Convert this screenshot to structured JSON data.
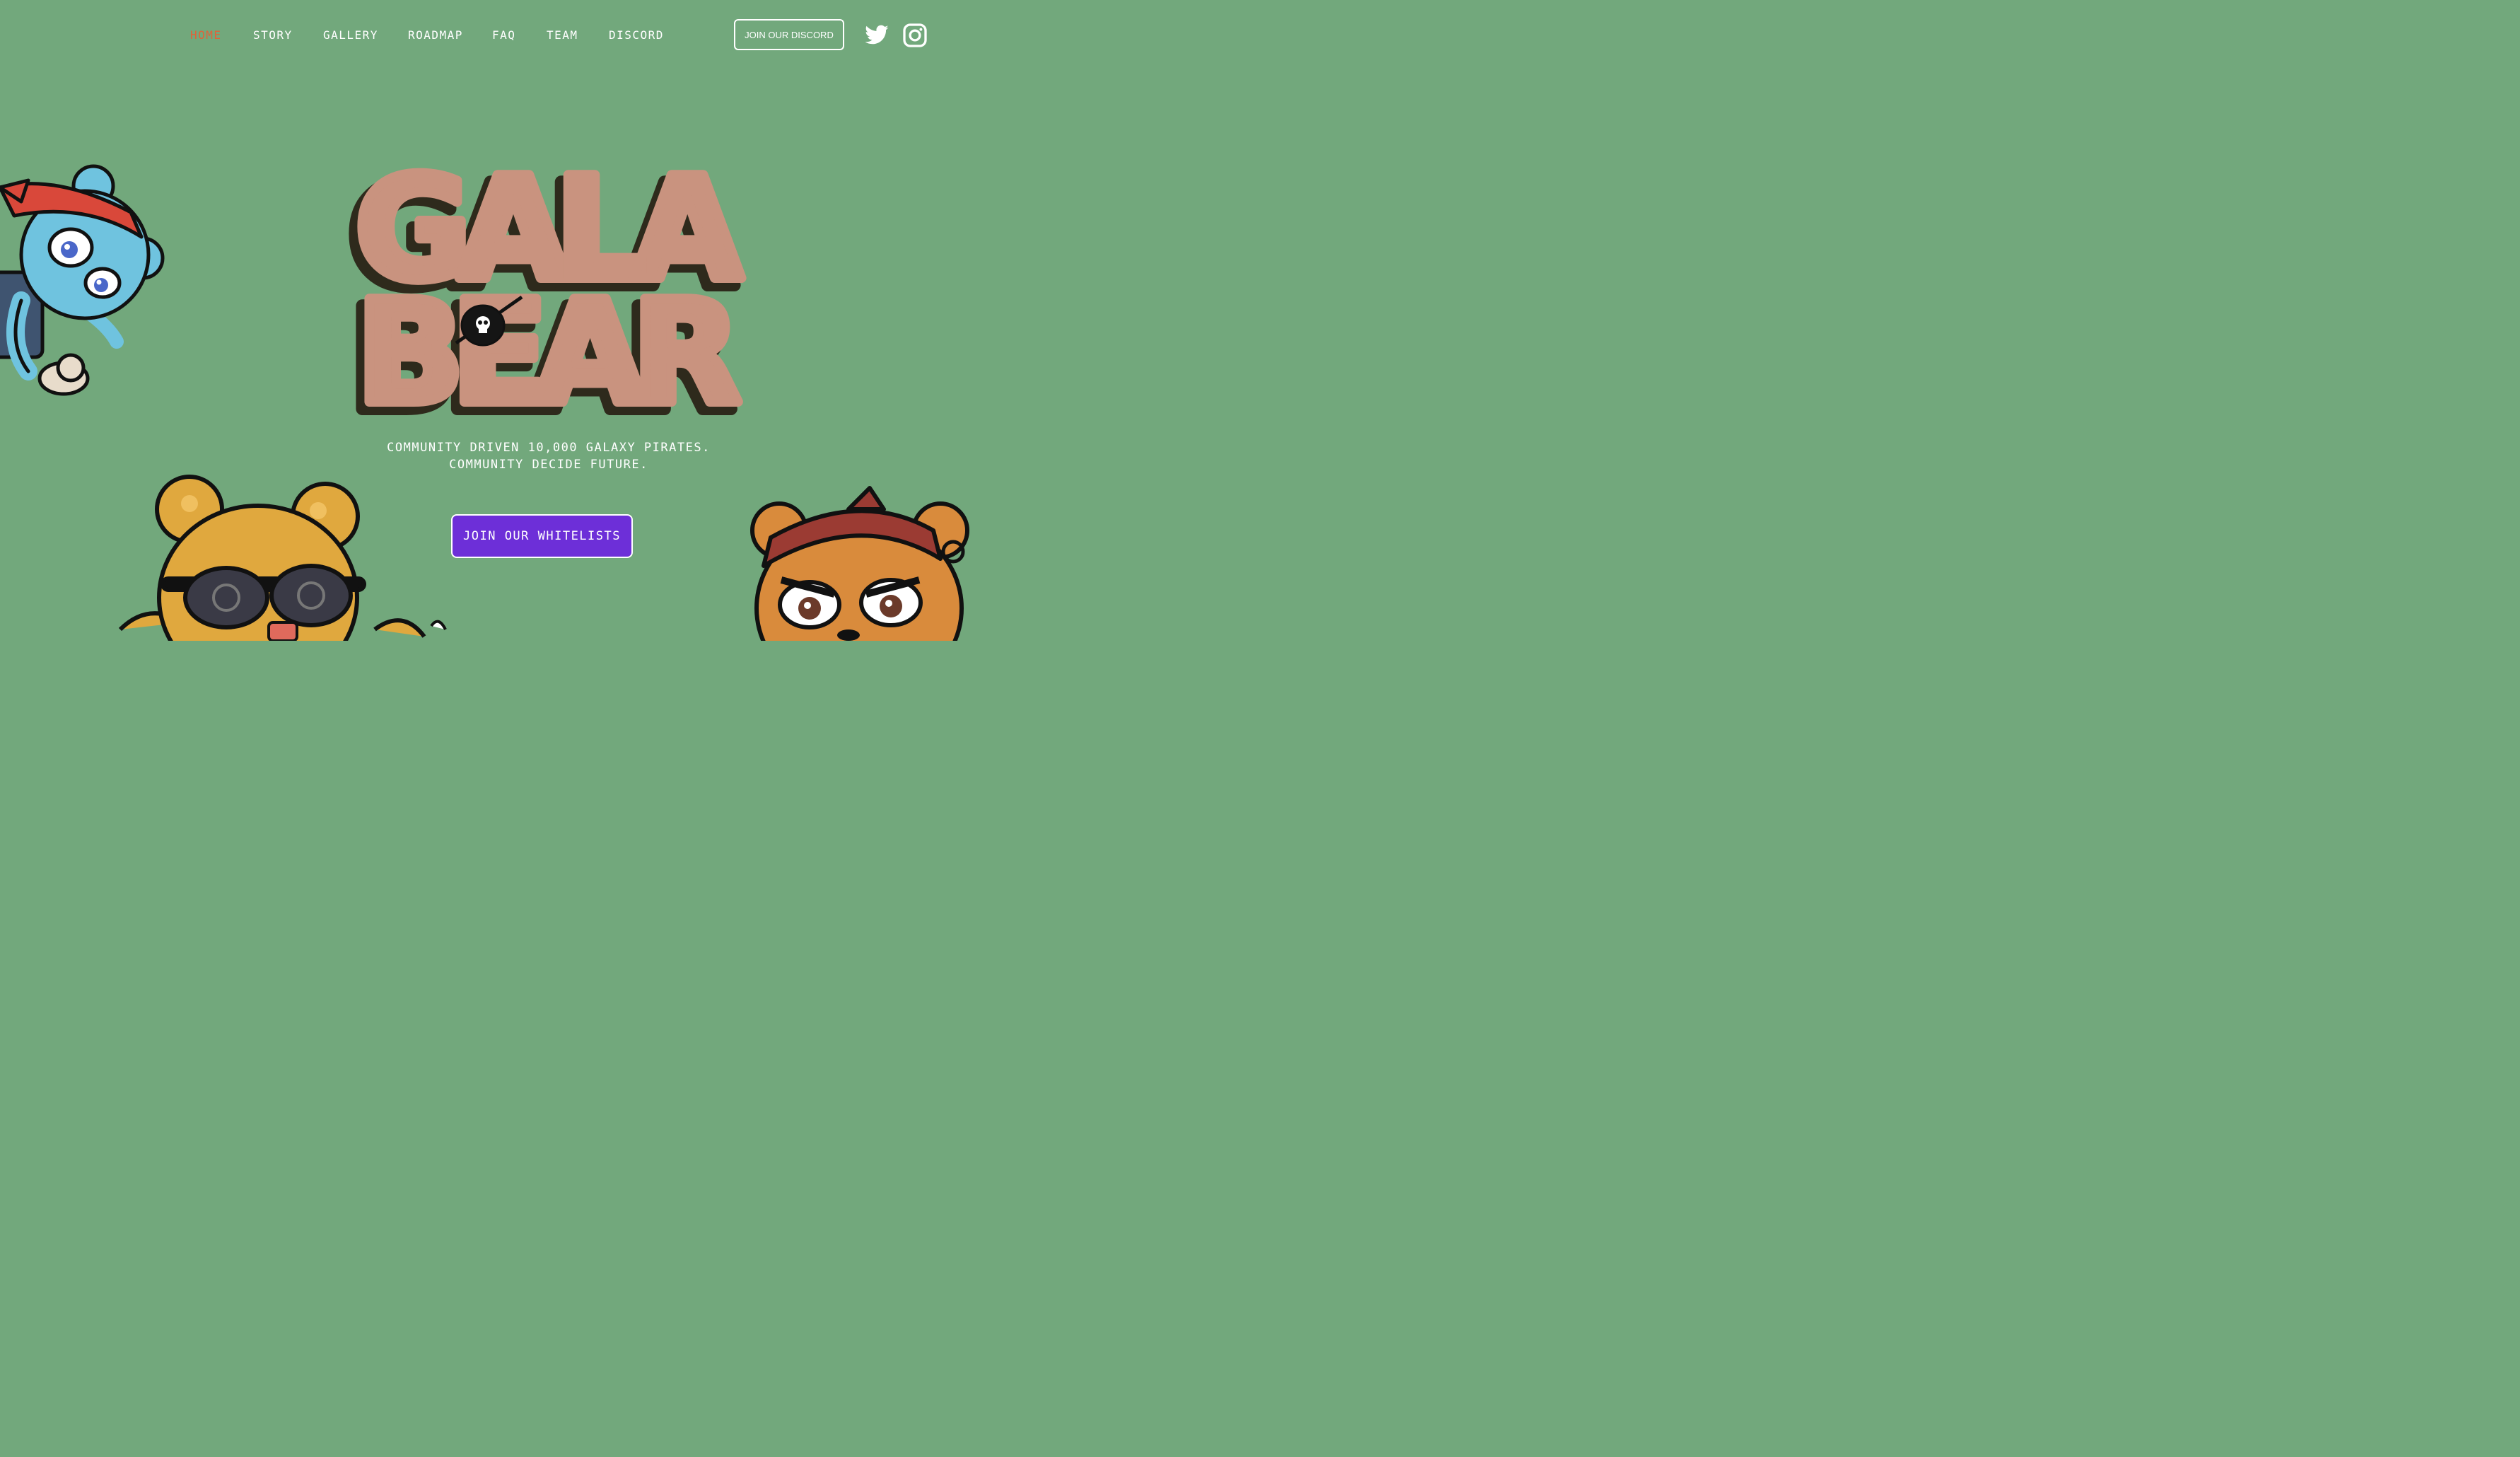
{
  "nav": {
    "items": [
      {
        "label": "HOME",
        "active": true
      },
      {
        "label": "STORY"
      },
      {
        "label": "GALLERY"
      },
      {
        "label": "ROADMAP"
      },
      {
        "label": "FAQ"
      },
      {
        "label": "TEAM"
      },
      {
        "label": "DISCORD"
      }
    ],
    "discord_button": "JOIN OUR DISCORD",
    "social": [
      "twitter-icon",
      "instagram-icon"
    ]
  },
  "hero": {
    "logo_text": [
      "GALA",
      "BEAR"
    ],
    "tagline_line1": "COMMUNITY DRIVEN 10,000 GALAXY PIRATES.",
    "tagline_line2": "COMMUNITY DECIDE FUTURE.",
    "cta_label": "JOIN OUR WHITELISTS"
  },
  "colors": {
    "background": "#72a87c",
    "active_nav": "#e0633a",
    "cta": "#6d2fd8",
    "logo_fill": "#c9937f",
    "logo_shadow": "#2e2a1c"
  }
}
